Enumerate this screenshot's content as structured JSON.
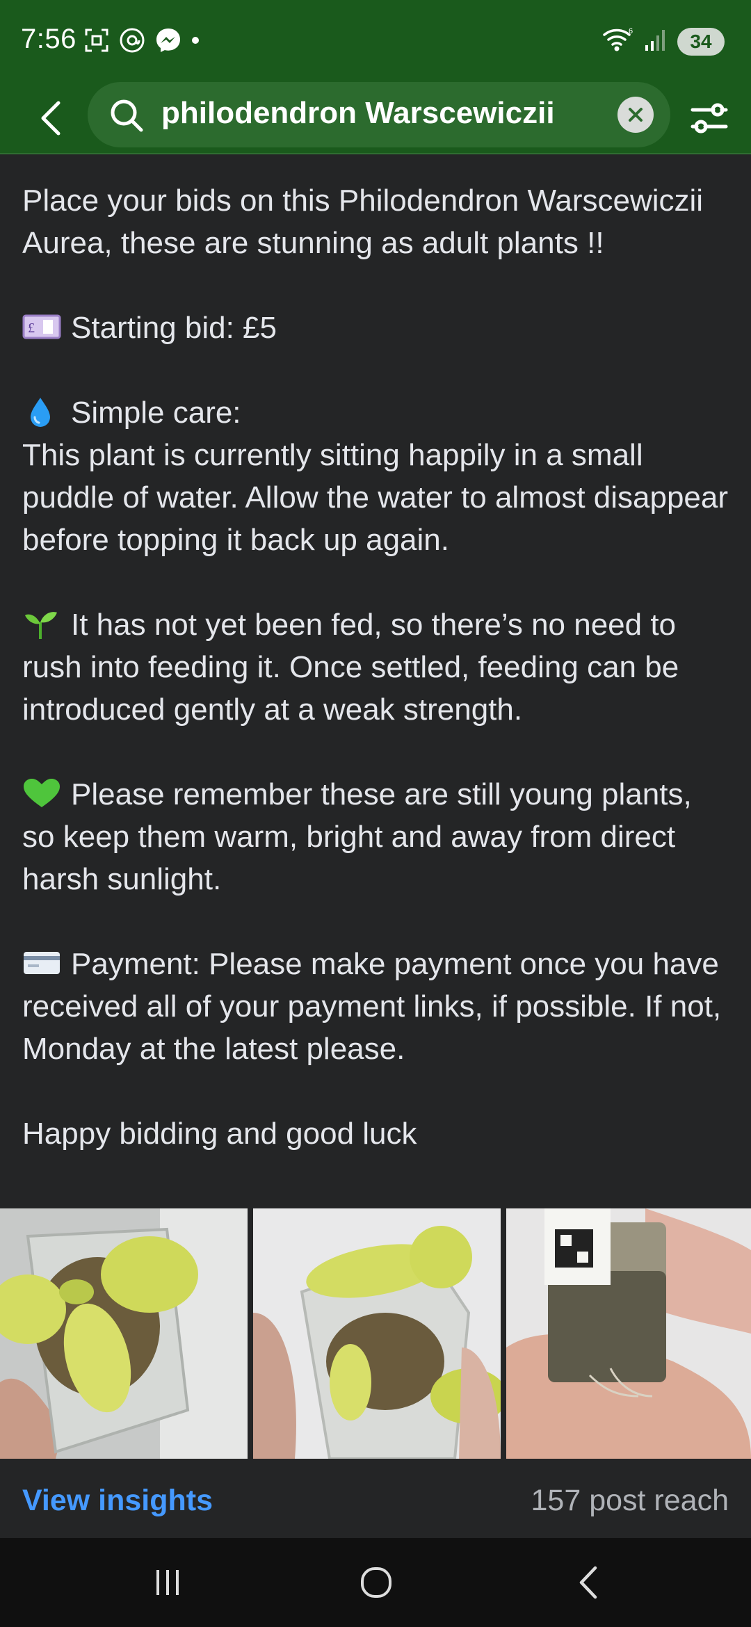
{
  "status_bar": {
    "time": "7:56",
    "battery": "34",
    "icons_left": [
      "screenshot-icon",
      "threads-icon",
      "messenger-icon",
      "notification-dot-icon"
    ],
    "icons_right": [
      "wifi-icon",
      "signal-icon",
      "battery-icon"
    ]
  },
  "search": {
    "query": "philodendron Warscewiczii"
  },
  "post": {
    "paragraphs": {
      "intro": "Place your bids on this Philodendron Warscewiczii Aurea, these are stunning as adult plants !!",
      "starting_bid": "Starting bid: £5",
      "care_heading": "Simple care:",
      "care_text": "This plant is currently sitting happily in a small puddle of water. Allow the water to almost disappear before topping it back up again.",
      "feeding": "It has not yet been fed, so there’s no need to rush into feeding it. Once settled, feeding can be introduced gently at a weak strength.",
      "young_plants": "Please remember these are still young plants, so keep them warm, bright and away from direct harsh sunlight.",
      "payment": "Payment: Please make payment once you have received all of your payment links, if possible. If not, Monday at the latest please.",
      "closing": "Happy bidding and good luck"
    },
    "emojis": {
      "starting_bid": "pound-banknote-icon",
      "care": "droplet-icon",
      "feeding": "seedling-icon",
      "young_plants": "green-heart-icon",
      "payment": "credit-card-icon"
    },
    "photos": [
      "plant-photo-1",
      "plant-photo-2",
      "plant-photo-3"
    ]
  },
  "footer": {
    "view_insights": "View insights",
    "post_reach": "157 post reach"
  },
  "colors": {
    "header_green": "#1a5a1c",
    "search_green": "#2c6b2e",
    "background": "#242526",
    "link_blue": "#4599ff",
    "muted_text": "#b0b3b8"
  }
}
